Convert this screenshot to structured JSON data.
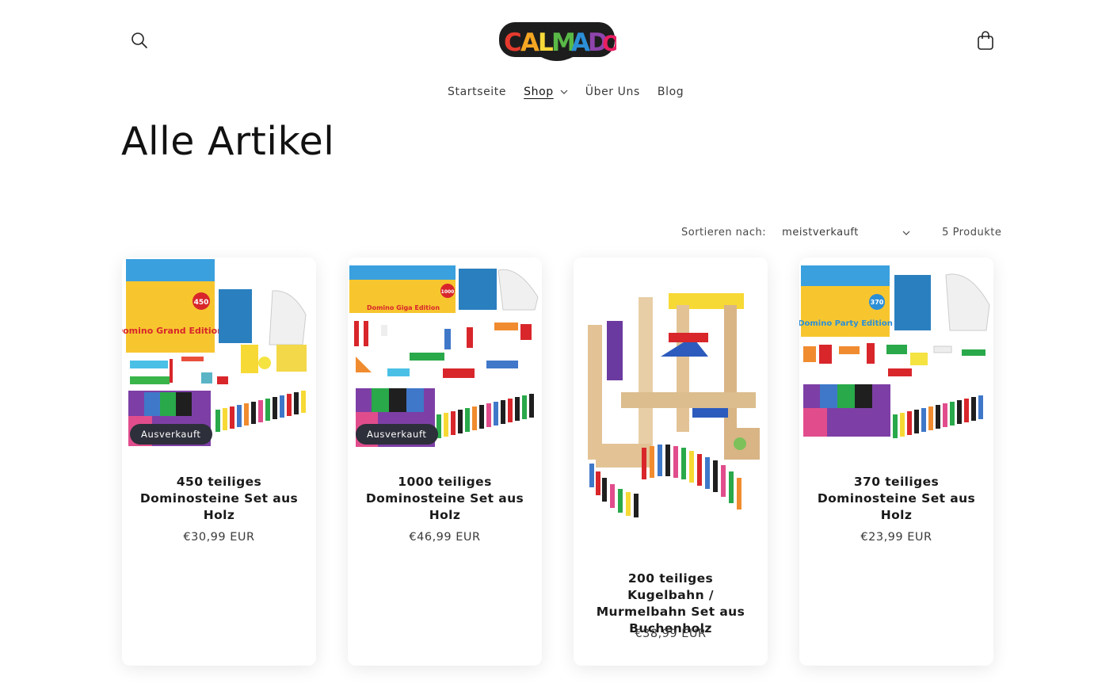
{
  "brand": {
    "logo_text": "CALMADO"
  },
  "header": {
    "search_icon": "search-icon",
    "cart_icon": "cart-icon"
  },
  "nav": {
    "items": [
      {
        "label": "Startseite"
      },
      {
        "label": "Shop"
      },
      {
        "label": "Über Uns"
      },
      {
        "label": "Blog"
      }
    ]
  },
  "page": {
    "title": "Alle Artikel"
  },
  "sort": {
    "label": "Sortieren nach:",
    "selected": "meistverkauft",
    "count": "5 Produkte"
  },
  "products": [
    {
      "title": "450 teiliges Dominosteine Set aus Holz",
      "price": "€30,99 EUR",
      "badge": "Ausverkauft",
      "box_label": "Domino Grand Edition",
      "count": "450"
    },
    {
      "title": "1000 teiliges Dominosteine Set aus Holz",
      "price": "€46,99 EUR",
      "badge": "Ausverkauft",
      "box_label": "Domino Giga Edition",
      "count": "1000"
    },
    {
      "title": "200 teiliges Kugelbahn / Murmelbahn Set aus Buchenholz",
      "price": "€38,99 EUR",
      "badge": ""
    },
    {
      "title": "370 teiliges Dominosteine Set aus Holz",
      "price": "€23,99 EUR",
      "badge": "",
      "box_label": "Domino Party Edition",
      "count": "370"
    }
  ],
  "colors": {
    "badge_bg": "#2d2f3a",
    "text": "#121212"
  }
}
